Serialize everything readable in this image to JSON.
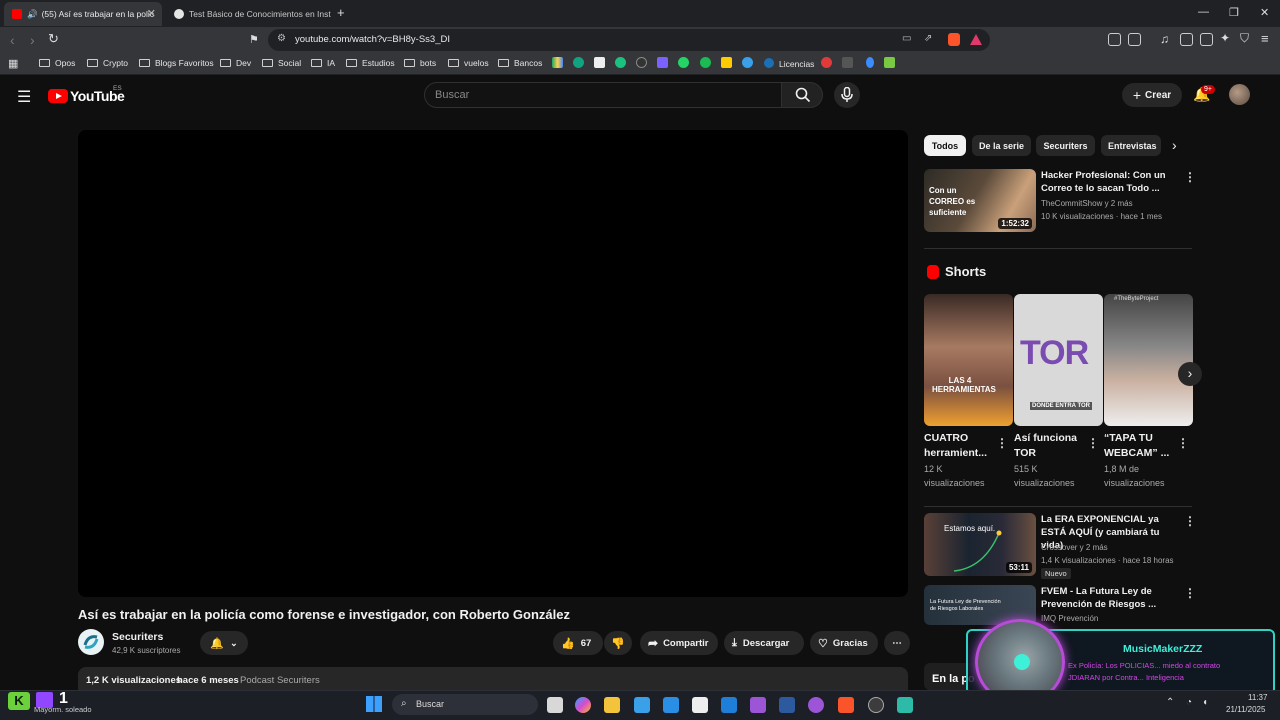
{
  "browser": {
    "tabs": [
      {
        "title": "(55) Así es trabajar en la polic",
        "active": true
      },
      {
        "title": "Test Básico de Conocimientos en Inst",
        "active": false
      }
    ],
    "new_tab": "+",
    "url": "youtube.com/watch?v=BH8y-Ss3_DI",
    "bookmarks": [
      "Opos",
      "Crypto",
      "Blogs Favoritos",
      "Dev",
      "Social",
      "IA",
      "Estudios",
      "bots",
      "vuelos",
      "Bancos"
    ],
    "licencias": "Licencias"
  },
  "youtube": {
    "logo": "YouTube",
    "region": "ES",
    "search_placeholder": "Buscar",
    "create_label": "Crear",
    "notif_count": "9+",
    "video": {
      "title": "Así es trabajar en la policía como forense e investigador, con Roberto González",
      "channel": "Securiters",
      "subscribers": "42,9 K suscriptores",
      "likes": "67",
      "share": "Compartir",
      "download": "Descargar",
      "thanks": "Gracias",
      "views": "1,2 K visualizaciones",
      "age": "hace 6 meses",
      "playlist": "Podcast Securiters"
    },
    "chips": [
      "Todos",
      "De la serie",
      "Securiters",
      "Entrevistas"
    ],
    "related": [
      {
        "title": "Hacker Profesional: Con un Correo te lo sacan Todo ...",
        "channel": "TheCommitShow y 2 más",
        "meta": "10 K visualizaciones · hace 1 mes",
        "duration": "1:52:32",
        "thumb_text": "Con un CORREO es suficiente"
      },
      {
        "title": "La ERA EXPONENCIAL ya ESTÁ AQUÍ (y cambiará tu vida)",
        "channel": "Crossover y 2 más",
        "meta": "1,4 K visualizaciones · hace 18 horas",
        "duration": "53:11",
        "badge": "Nuevo",
        "thumb_text": "Estamos aquí."
      },
      {
        "title": "FVEM - La Futura Ley de Prevención de Riesgos ...",
        "channel": "IMQ Prevención",
        "thumb_text": "La Futura Ley de Prevención de Riesgos Laborales"
      }
    ],
    "shorts_heading": "Shorts",
    "shorts": [
      {
        "title": "CUATRO herramient...",
        "views": "12 K visualizaciones",
        "thumb_text": "LAS 4 HERRAMIENTAS"
      },
      {
        "title": "Así funciona TOR",
        "views": "515 K visualizaciones",
        "thumb_text": "TOR",
        "sub_text": "DONDE ENTRA TOR"
      },
      {
        "title": "“TAPA TU WEBCAM” ...",
        "views": "1,8 M de visualizaciones",
        "thumb_text": "#TheByteProject"
      }
    ]
  },
  "overlay": {
    "name": "MusicMakerZZZ",
    "line1": "Ex Policía: Los POLICIAS... miedo al contrato",
    "line2": "JDIARAN por Contra... Inteligencia",
    "thumb_caption": "En la po"
  },
  "taskbar": {
    "weather": "Mayorm. soleado",
    "search": "Buscar",
    "count": "1",
    "time": "11:37",
    "date": "21/11/2025"
  }
}
